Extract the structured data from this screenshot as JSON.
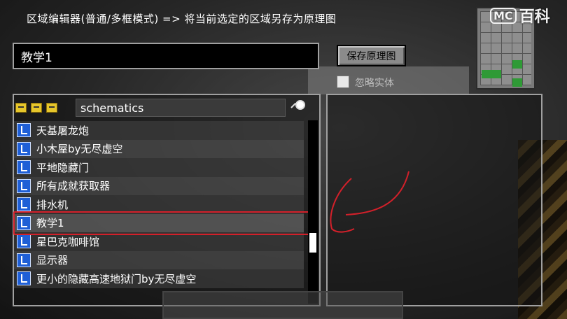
{
  "window": {
    "title": "区域编辑器(普通/多框模式) => 将当前选定的区域另存为原理图"
  },
  "name_field": {
    "value": "教学1"
  },
  "save_button": {
    "label": "保存原理图"
  },
  "ignore_entities": {
    "label": "忽略实体",
    "checked": false
  },
  "search": {
    "value": "schematics"
  },
  "files": [
    {
      "label": "天基屠龙炮"
    },
    {
      "label": "小木屋by无尽虚空"
    },
    {
      "label": "平地隐藏门"
    },
    {
      "label": "所有成就获取器"
    },
    {
      "label": "排水机"
    },
    {
      "label": "教学1",
      "selected": true
    },
    {
      "label": "星巴克咖啡馆"
    },
    {
      "label": "显示器"
    },
    {
      "label": "更小的隐藏高速地狱门by无尽虚空"
    }
  ],
  "icons": [
    "folder-up-icon",
    "folder-back-icon",
    "folder-new-icon",
    "search-magnifier-icon",
    "schematic-file-icon"
  ],
  "colors": {
    "selection_frame": "#d3202a",
    "file_icon": "#1f5fd6"
  },
  "watermark": {
    "badge": "MC",
    "text": "百科"
  }
}
